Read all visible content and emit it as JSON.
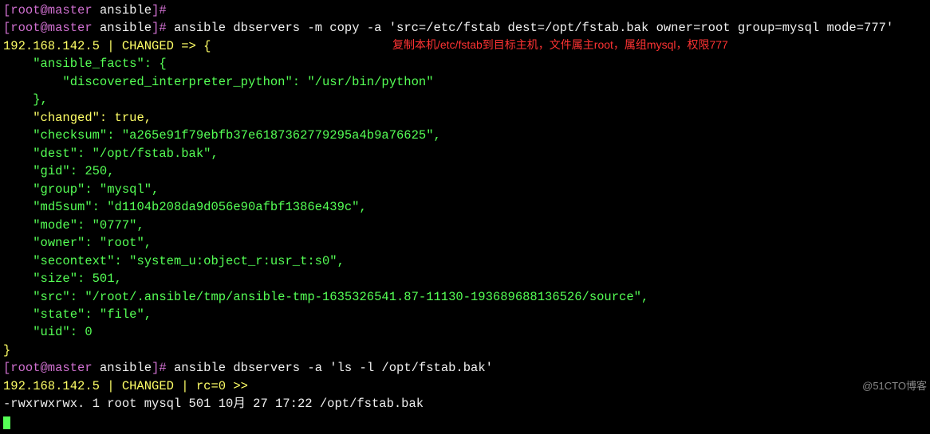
{
  "prompt_top": {
    "user_host": "[root@master",
    "dir": "ansible",
    "suffix": "]#"
  },
  "cmd1": {
    "prefix_user": "[root@master",
    "prefix_dir": "ansible",
    "prefix_close": "]#",
    "text": " ansible dbservers -m copy -a 'src=/etc/fstab dest=/opt/fstab.bak owner=root group=mysql mode=777'"
  },
  "annotation": "复制本机/etc/fstab到目标主机，文件属主root，属组mysql，权限777",
  "result_header": "192.168.142.5 | CHANGED => {",
  "facts_open": "    \"ansible_facts\": {",
  "interp": "        \"discovered_interpreter_python\": \"/usr/bin/python\"",
  "facts_close": "    },",
  "changed": "    \"changed\": true,",
  "checksum": "    \"checksum\": \"a265e91f79ebfb37e6187362779295a4b9a76625\",",
  "dest": "    \"dest\": \"/opt/fstab.bak\",",
  "gid": "    \"gid\": 250,",
  "group": "    \"group\": \"mysql\",",
  "md5sum": "    \"md5sum\": \"d1104b208da9d056e90afbf1386e439c\",",
  "mode": "    \"mode\": \"0777\",",
  "owner": "    \"owner\": \"root\",",
  "secontext": "    \"secontext\": \"system_u:object_r:usr_t:s0\",",
  "size": "    \"size\": 501,",
  "src": "    \"src\": \"/root/.ansible/tmp/ansible-tmp-1635326541.87-11130-193689688136526/source\",",
  "state": "    \"state\": \"file\",",
  "uid": "    \"uid\": 0",
  "brace_close": "}",
  "cmd2": {
    "prefix_user": "[root@master",
    "prefix_dir": "ansible",
    "prefix_close": "]#",
    "text": " ansible dbservers -a 'ls -l /opt/fstab.bak'"
  },
  "result2_header": "192.168.142.5 | CHANGED | rc=0 >>",
  "ls_output": "-rwxrwxrwx. 1 root mysql 501 10月 27 17:22 /opt/fstab.bak",
  "watermark": "@51CTO博客"
}
